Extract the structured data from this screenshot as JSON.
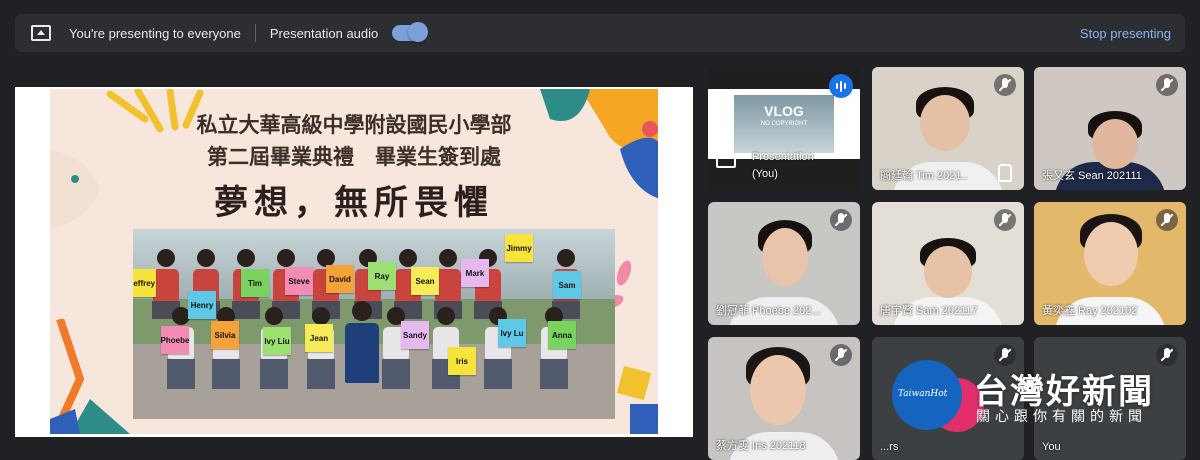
{
  "topbar": {
    "presenting_text": "You're presenting to everyone",
    "audio_label": "Presentation audio",
    "stop_label": "Stop presenting"
  },
  "slide": {
    "title_line1": "私立大華高級中學附設國民小學部",
    "title_line2": "第二屆畢業典禮　畢業生簽到處",
    "motto": "夢想，無所畏懼",
    "back_row_signs": [
      "Jeffrey",
      "Henry",
      "Tim",
      "Steve",
      "David",
      "Ray",
      "Sean",
      "Mark",
      "Jimmy",
      "Sam"
    ],
    "front_row_signs": [
      "Phoebe",
      "Silvia",
      "Ivy Liu",
      "Jean",
      "Sandy",
      "Iris",
      "Ivy Lu",
      "Anna"
    ],
    "sign_colors": [
      "#f7e43a",
      "#5ec8e6",
      "#78d45e",
      "#f28cb4",
      "#f5a23a",
      "#9ce072",
      "#f7ec58",
      "#e6b8f0"
    ]
  },
  "participants": [
    {
      "name": "Presentation\n(You)",
      "type": "presentation",
      "video_text": "VLOG",
      "video_sub": "NO COPYRIGHT"
    },
    {
      "name": "簡廷翰 Tim 2021..",
      "type": "person"
    },
    {
      "name": "張又玄 Sean 202111",
      "type": "person"
    },
    {
      "name": "劉冠菲 Phoebe 202...",
      "type": "person"
    },
    {
      "name": "唐宇賢 Sam 202117",
      "type": "person"
    },
    {
      "name": "黃奕鑫 Ray 202102",
      "type": "person"
    },
    {
      "name": "蔡方雯 Iris 202118",
      "type": "person"
    },
    {
      "name": "...rs",
      "type": "avatar"
    },
    {
      "name": "You",
      "type": "avatar"
    }
  ],
  "watermark": {
    "logo_text": "TaiwanHot",
    "title": "台灣好新聞",
    "subtitle": "關心跟你有關的新聞"
  },
  "colors": {
    "background": "#202124",
    "accent": "#8ab4f8",
    "tile": "#3c4043"
  },
  "icons": [
    "present-screen-icon",
    "mic-off-icon",
    "audio-level-icon",
    "hand-raise-icon"
  ]
}
